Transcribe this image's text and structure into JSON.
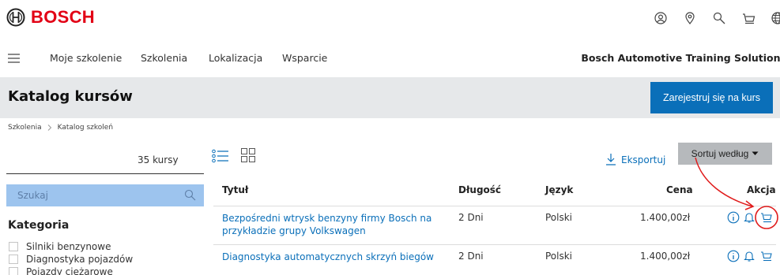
{
  "brand": {
    "logo_text": "BOSCH"
  },
  "header_icons": [
    "account-icon",
    "location-pin-icon",
    "search-icon",
    "cart-icon",
    "globe-icon"
  ],
  "nav": {
    "items": [
      "Moje szkolenie",
      "Szkolenia",
      "Lokalizacja",
      "Wsparcie"
    ],
    "brand_label": "Bosch Automotive Training Solutions"
  },
  "page": {
    "title": "Katalog kursów",
    "register_label": "Zarejestruj się na kurs"
  },
  "breadcrumb": [
    "Szkolenia",
    "Katalog szkoleń"
  ],
  "sidebar": {
    "count_label": "35 kursy",
    "search_placeholder": "Szukaj",
    "category_title": "Kategoria",
    "categories": [
      "Silniki benzynowe",
      "Diagnostyka pojazdów",
      "Pojazdy ciężarowe"
    ]
  },
  "toolbar": {
    "export_label": "Eksportuj",
    "sort_label": "Sortuj według"
  },
  "table": {
    "headers": {
      "title": "Tytuł",
      "length": "Długość",
      "language": "Język",
      "price": "Cena",
      "action": "Akcja"
    },
    "rows": [
      {
        "title": "Bezpośredni wtrysk benzyny firmy Bosch na przykładzie grupy Volkswagen",
        "length": "2 Dni",
        "language": "Polski",
        "price": "1.400,00zł"
      },
      {
        "title": "Diagnostyka automatycznych skrzyń biegów",
        "length": "2 Dni",
        "language": "Polski",
        "price": "1.400,00zł"
      }
    ]
  },
  "colors": {
    "brand_red": "#e20015",
    "primary_blue": "#0a6fb9",
    "annotation_red": "#e01b1b"
  }
}
